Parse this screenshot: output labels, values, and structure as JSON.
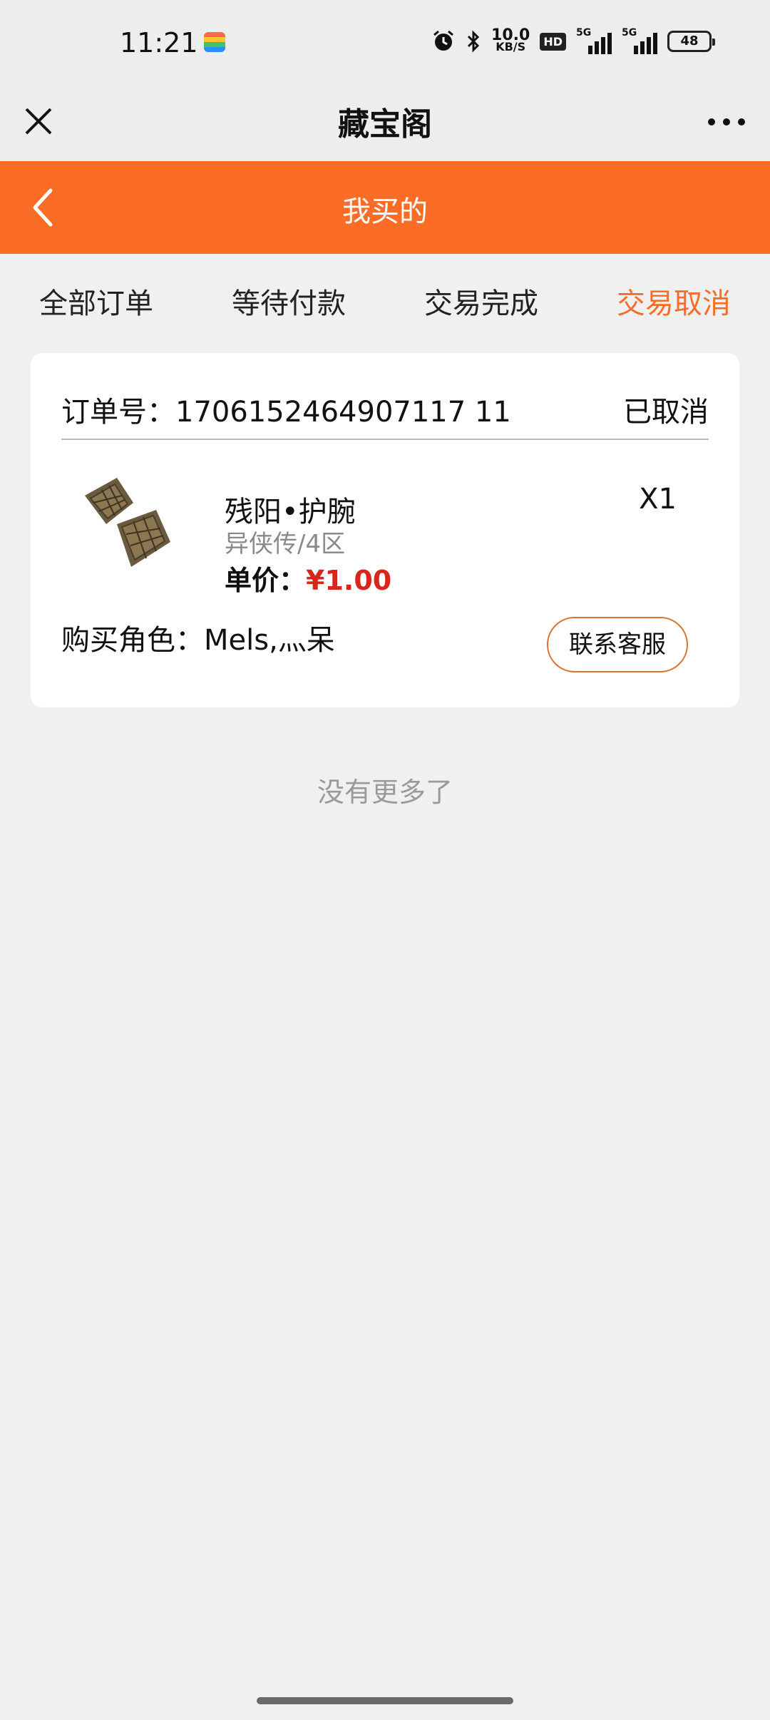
{
  "status_bar": {
    "time": "11:21",
    "net_speed_value": "10.0",
    "net_speed_unit": "KB/S",
    "hd_badge": "HD",
    "signal1_label": "5G",
    "signal2_label": "5G",
    "battery_level": "48"
  },
  "title_bar": {
    "title": "藏宝阁"
  },
  "header": {
    "title": "我买的"
  },
  "tabs": [
    {
      "label": "全部订单",
      "active": false
    },
    {
      "label": "等待付款",
      "active": false
    },
    {
      "label": "交易完成",
      "active": false
    },
    {
      "label": "交易取消",
      "active": true
    }
  ],
  "order": {
    "order_no_label": "订单号：",
    "order_no": "1706152464907117 11",
    "status": "已取消",
    "product_name": "残阳•护腕",
    "server": "异侠传/4区",
    "price_label": "单价：",
    "price": "¥1.00",
    "quantity": "X1",
    "role_label": "购买角色：",
    "role_name": "Mels,灬呆",
    "contact_button": "联系客服"
  },
  "footer": {
    "no_more_text": "没有更多了"
  },
  "colors": {
    "accent": "#fb6d26",
    "price": "#d9261c",
    "background": "#f0f0f0"
  }
}
